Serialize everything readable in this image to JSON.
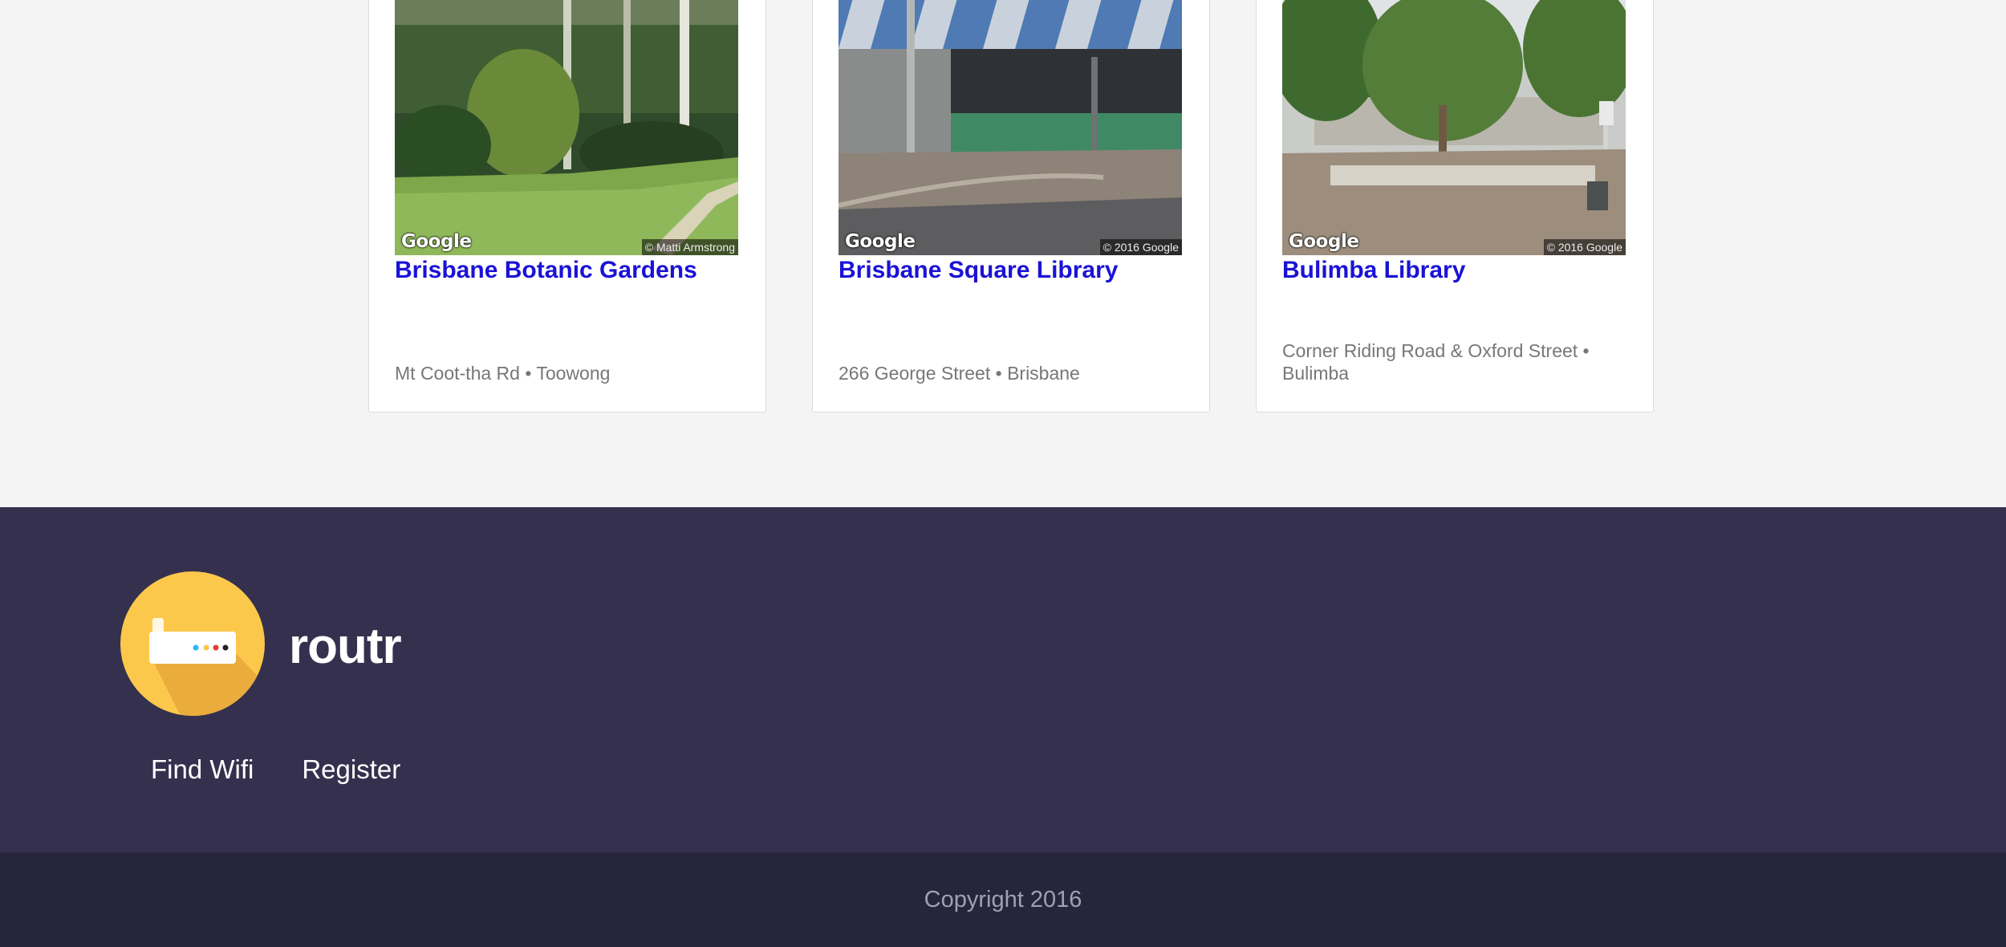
{
  "cards": [
    {
      "title": "Brisbane Botanic Gardens",
      "address": "Mt Coot-tha Rd • Toowong",
      "image_watermark": "Google",
      "image_credit": "© Matti Armstrong"
    },
    {
      "title": "Brisbane Square Library",
      "address": "266 George Street • Brisbane",
      "image_watermark": "Google",
      "image_credit": "© 2016 Google"
    },
    {
      "title": "Bulimba Library",
      "address": "Corner Riding Road & Oxford Street • Bulimba",
      "image_watermark": "Google",
      "image_credit": "© 2016 Google"
    }
  ],
  "footer": {
    "logo_icon": "router-icon",
    "brand": "routr",
    "nav": [
      "Find Wifi",
      "Register"
    ]
  },
  "bottom": {
    "copyright": "Copyright 2016"
  },
  "colors": {
    "page_bg": "#f4f4f4",
    "card_title": "#1a12d6",
    "footer_bg": "#34304e",
    "bottom_bg": "#27253b",
    "logo_bg": "#fcc84b"
  }
}
